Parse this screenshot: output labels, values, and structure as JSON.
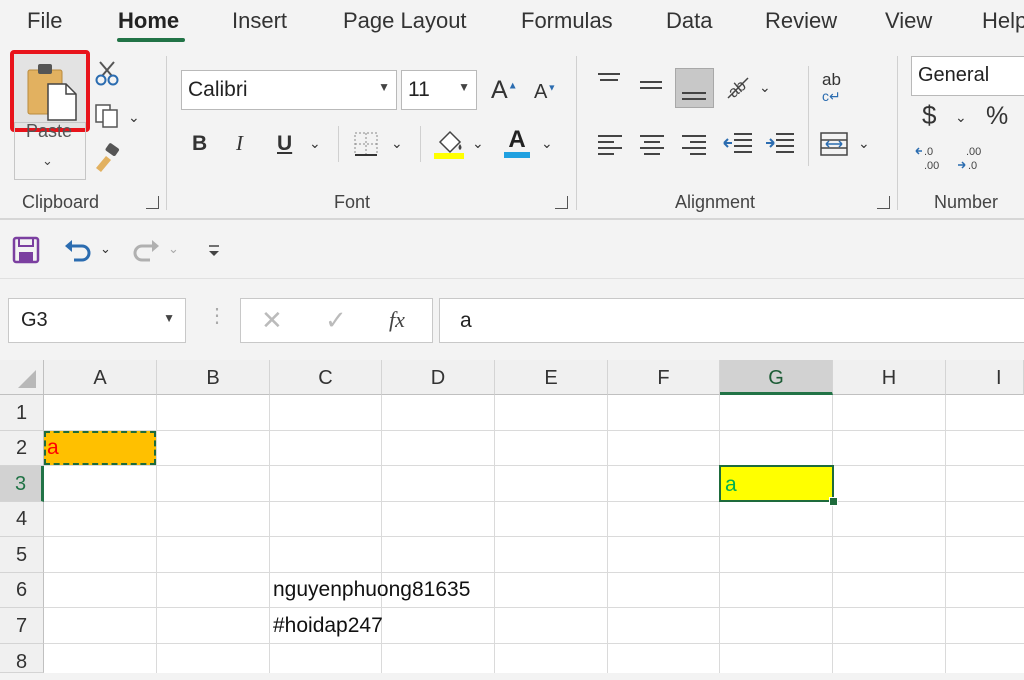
{
  "menu": {
    "tabs": [
      "File",
      "Home",
      "Insert",
      "Page Layout",
      "Formulas",
      "Data",
      "Review",
      "View",
      "Help"
    ],
    "active": "Home"
  },
  "ribbon": {
    "clipboard": {
      "paste_label": "Paste",
      "group_label": "Clipboard"
    },
    "font": {
      "font_name": "Calibri",
      "font_size": "11",
      "group_label": "Font",
      "bold": "B",
      "italic": "I",
      "underline": "U",
      "grow": "A",
      "shrink": "A",
      "font_color_glyph": "A"
    },
    "alignment": {
      "group_label": "Alignment",
      "wrap_glyph": "ab"
    },
    "number": {
      "format": "General",
      "group_label": "Number",
      "currency": "$",
      "percent": "%"
    }
  },
  "formula_bar": {
    "name_box": "G3",
    "fx": "fx",
    "value": "a"
  },
  "sheet": {
    "columns": [
      "A",
      "B",
      "C",
      "D",
      "E",
      "F",
      "G",
      "H",
      "I"
    ],
    "selected_column": "G",
    "rows": [
      "1",
      "2",
      "3",
      "4",
      "5",
      "6",
      "7",
      "8"
    ],
    "selected_row": "3",
    "cells": {
      "A2": "a",
      "G3": "a",
      "C6": "nguyenphuong81635",
      "C7": "#hoidap247"
    }
  },
  "colors": {
    "accent": "#217346",
    "a2_fill": "#ffc000",
    "a2_text": "#ff0000",
    "g3_fill": "#ffff00",
    "g3_text": "#00b050",
    "highlight_box": "#e8131b"
  }
}
